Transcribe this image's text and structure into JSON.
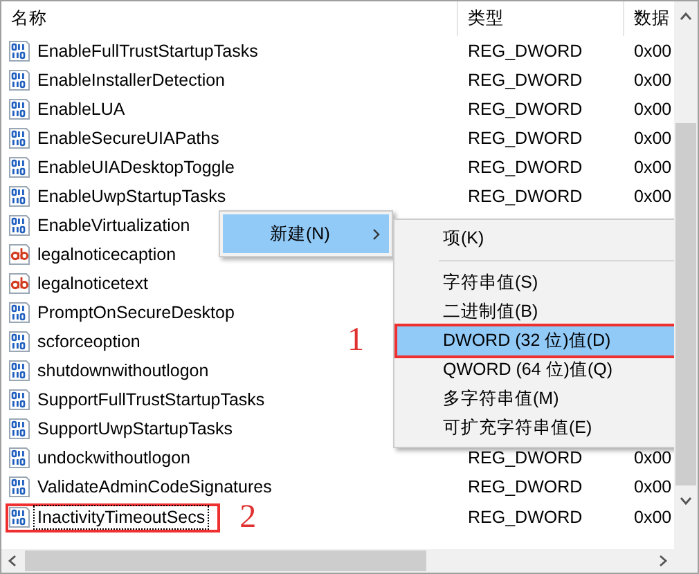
{
  "columns": [
    {
      "label": "名称"
    },
    {
      "label": "类型"
    },
    {
      "label": "数据"
    }
  ],
  "rows": [
    {
      "kind": "binary",
      "name": "EnableFullTrustStartupTasks",
      "type": "REG_DWORD",
      "data": "0x00",
      "focused": false
    },
    {
      "kind": "binary",
      "name": "EnableInstallerDetection",
      "type": "REG_DWORD",
      "data": "0x00",
      "focused": false
    },
    {
      "kind": "binary",
      "name": "EnableLUA",
      "type": "REG_DWORD",
      "data": "0x00",
      "focused": false
    },
    {
      "kind": "binary",
      "name": "EnableSecureUIAPaths",
      "type": "REG_DWORD",
      "data": "0x00",
      "focused": false
    },
    {
      "kind": "binary",
      "name": "EnableUIADesktopToggle",
      "type": "REG_DWORD",
      "data": "0x00",
      "focused": false
    },
    {
      "kind": "binary",
      "name": "EnableUwpStartupTasks",
      "type": "REG_DWORD",
      "data": "0x00",
      "focused": false
    },
    {
      "kind": "binary",
      "name": "EnableVirtualization",
      "focused": false
    },
    {
      "kind": "string",
      "name": "legalnoticecaption",
      "focused": false
    },
    {
      "kind": "string",
      "name": "legalnoticetext",
      "focused": false
    },
    {
      "kind": "binary",
      "name": "PromptOnSecureDesktop",
      "focused": false
    },
    {
      "kind": "binary",
      "name": "scforceoption",
      "focused": false
    },
    {
      "kind": "binary",
      "name": "shutdownwithoutlogon",
      "focused": false
    },
    {
      "kind": "binary",
      "name": "SupportFullTrustStartupTasks",
      "focused": false
    },
    {
      "kind": "binary",
      "name": "SupportUwpStartupTasks",
      "focused": false
    },
    {
      "kind": "binary",
      "name": "undockwithoutlogon",
      "type": "REG_DWORD",
      "data": "0x00",
      "focused": false
    },
    {
      "kind": "binary",
      "name": "ValidateAdminCodeSignatures",
      "type": "REG_DWORD",
      "data": "0x00",
      "focused": false
    },
    {
      "kind": "binary",
      "name": "InactivityTimeoutSecs",
      "type": "REG_DWORD",
      "data": "0x00",
      "focused": true,
      "callout": "2"
    }
  ],
  "context_menu": {
    "items": [
      {
        "label": "新建(N)",
        "selected": true,
        "submenu": true
      }
    ]
  },
  "submenu": {
    "items": [
      {
        "kind": "item",
        "label": "项(K)",
        "selected": false
      },
      {
        "kind": "separator"
      },
      {
        "kind": "item",
        "label": "字符串值(S)",
        "selected": false
      },
      {
        "kind": "item",
        "label": "二进制值(B)",
        "selected": false
      },
      {
        "kind": "item",
        "label": "DWORD (32 位)值(D)",
        "selected": true,
        "callout": "1"
      },
      {
        "kind": "item",
        "label": "QWORD (64 位)值(Q)",
        "selected": false
      },
      {
        "kind": "item",
        "label": "多字符串值(M)",
        "selected": false
      },
      {
        "kind": "item",
        "label": "可扩充字符串值(E)",
        "selected": false
      }
    ]
  }
}
